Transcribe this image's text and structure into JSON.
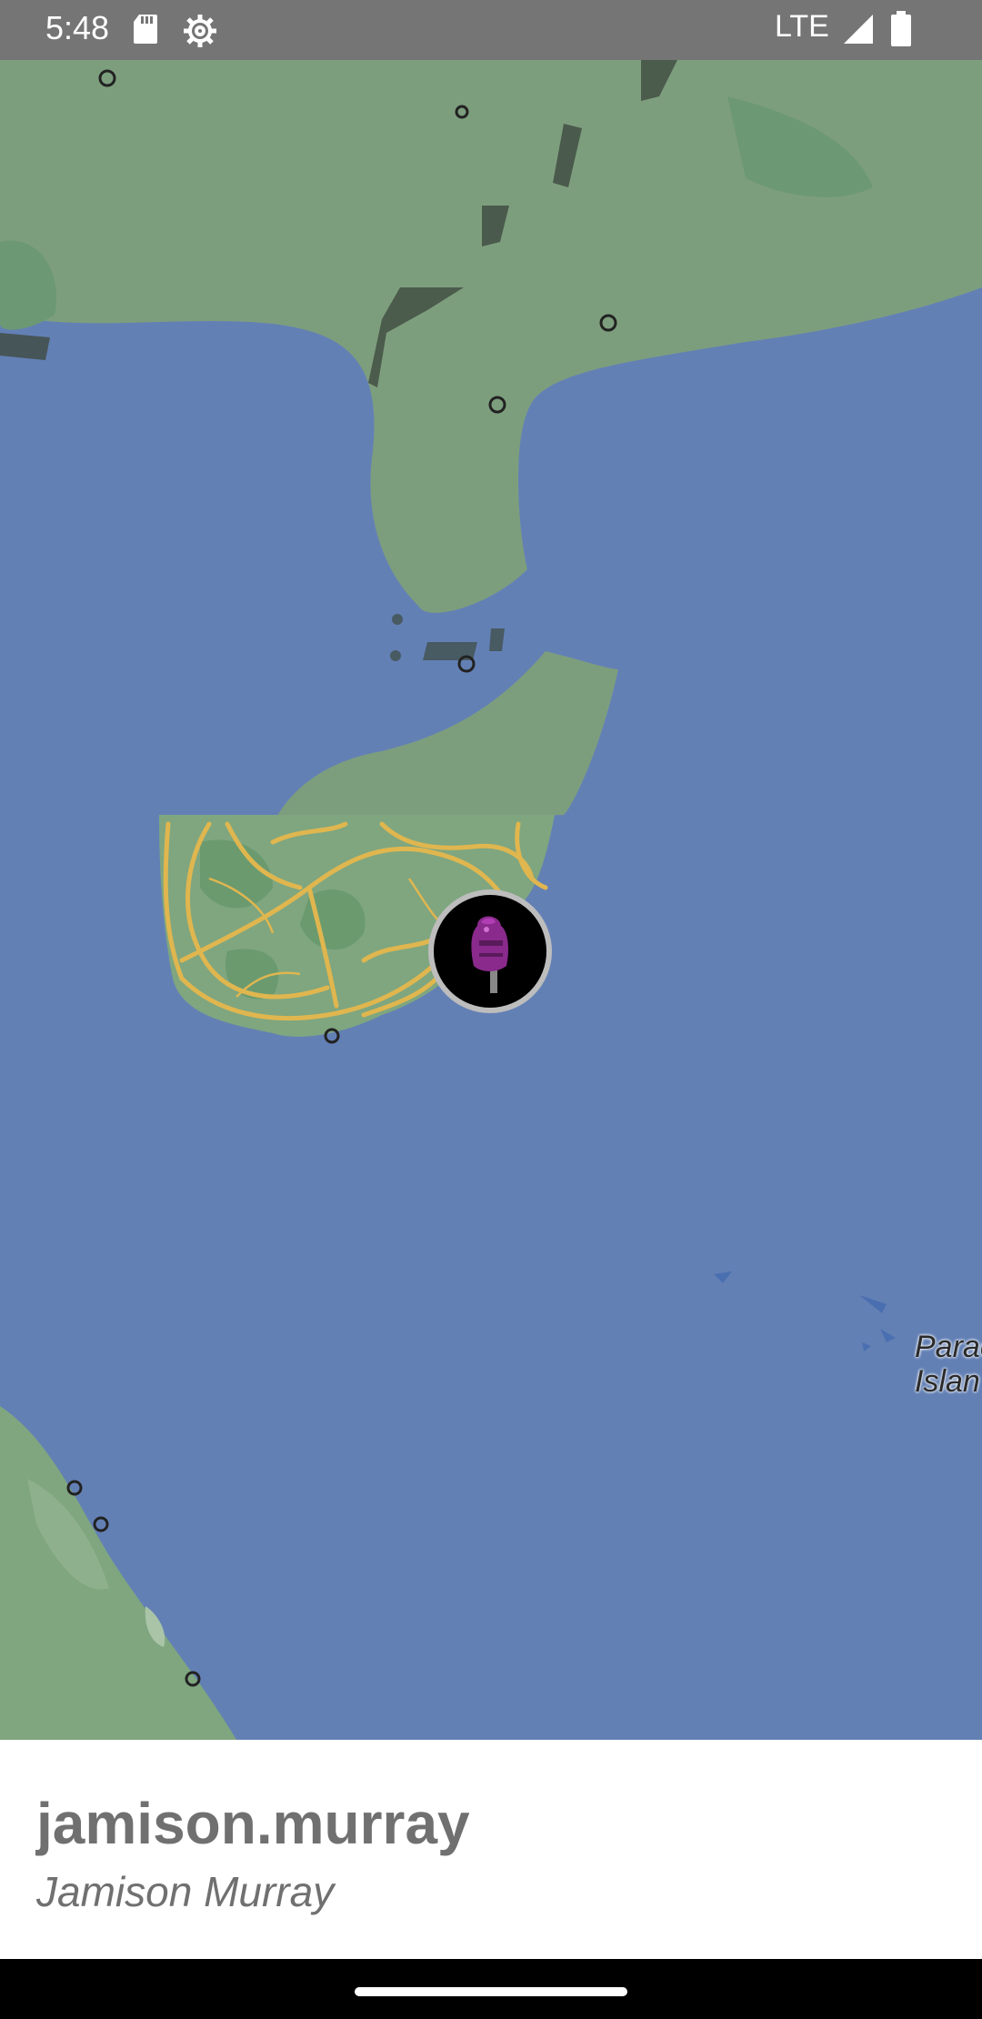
{
  "status_bar": {
    "time": "5:48",
    "network": "LTE",
    "icons": [
      "sd-card-icon",
      "settings-icon",
      "signal-icon",
      "battery-icon"
    ]
  },
  "map": {
    "place_label": "Parac\nIslan",
    "colors": {
      "water": "#6380b5",
      "land": "#7d9e7d",
      "road": "#e0b64f"
    }
  },
  "user": {
    "username": "jamison.murray",
    "full_name": "Jamison Murray"
  }
}
